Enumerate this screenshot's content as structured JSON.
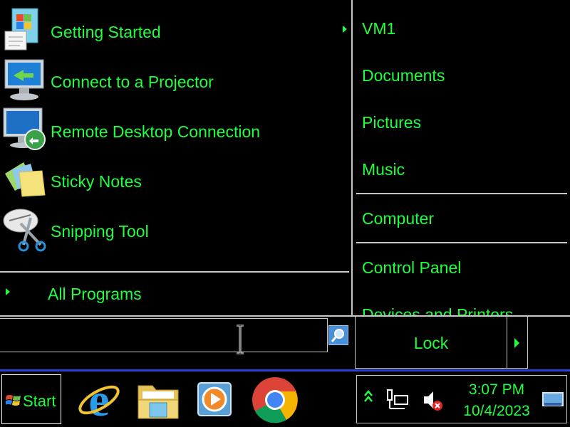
{
  "start_menu": {
    "programs": [
      {
        "label": "Getting Started",
        "icon": "getting-started-icon",
        "has_submenu": true
      },
      {
        "label": "Connect to a Projector",
        "icon": "projector-icon",
        "has_submenu": false
      },
      {
        "label": "Remote Desktop Connection",
        "icon": "remote-desktop-icon",
        "has_submenu": false
      },
      {
        "label": "Sticky Notes",
        "icon": "sticky-notes-icon",
        "has_submenu": false
      },
      {
        "label": "Snipping Tool",
        "icon": "snipping-tool-icon",
        "has_submenu": false
      }
    ],
    "all_programs": "All Programs",
    "search": {
      "value": "",
      "placeholder": ""
    },
    "right_items": [
      "VM1",
      "Documents",
      "Pictures",
      "Music",
      "Computer",
      "Control Panel",
      "Devices and Printers"
    ],
    "lock_label": "Lock"
  },
  "taskbar": {
    "start_label": "Start",
    "pinned": [
      "internet-explorer-icon",
      "file-explorer-icon",
      "media-player-icon",
      "chrome-icon"
    ],
    "tray": {
      "icons": [
        "show-hidden-icons-icon",
        "network-icon",
        "volume-muted-icon",
        "show-desktop-icon"
      ],
      "time": "3:07 PM",
      "date": "10/4/2023"
    }
  },
  "colors": {
    "text": "#1fff3f",
    "background": "#000000",
    "taskbar_border": "#2a3fd6",
    "divider": "#c8c8c8"
  }
}
